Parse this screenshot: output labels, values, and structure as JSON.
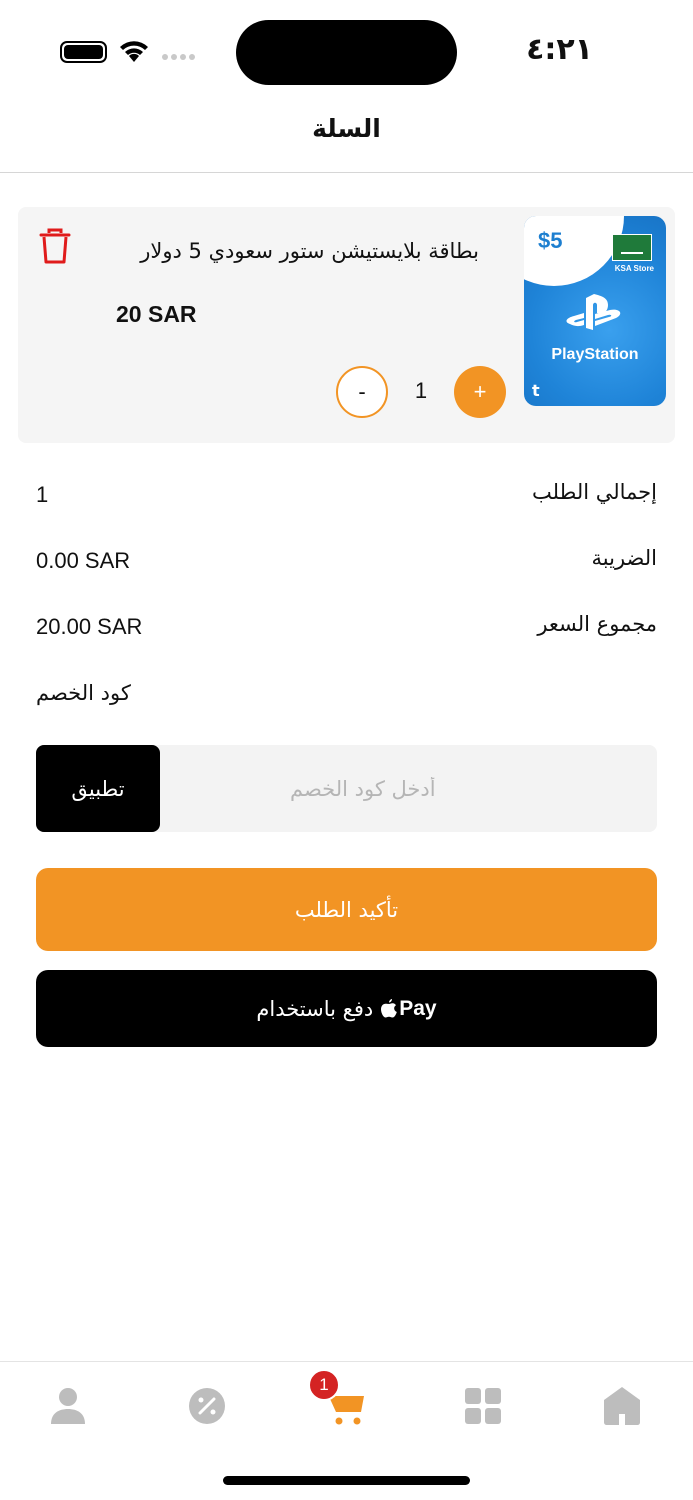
{
  "status_bar": {
    "time": "٤:٢١",
    "icons": [
      "battery-icon",
      "wifi-icon",
      "signal-icon"
    ]
  },
  "header": {
    "title": "السلة"
  },
  "cart": {
    "items": [
      {
        "name": "بطاقة بلايستيشن ستور سعودي 5 دولار",
        "price": "20 SAR",
        "quantity": "1",
        "minus_label": "-",
        "plus_label": "+",
        "image": {
          "price_tag": "$5",
          "region": "KSA Store",
          "brand": "PlayStation",
          "corner_mark": "t"
        }
      }
    ]
  },
  "summary": {
    "order_total_label": "إجمالي الطلب",
    "order_total_value": "1",
    "tax_label": "الضريبة",
    "tax_value": "0.00 SAR",
    "price_total_label": "مجموع السعر",
    "price_total_value": "20.00 SAR"
  },
  "coupon": {
    "title": "كود الخصم",
    "placeholder": "أدخل كود الخصم",
    "value": "",
    "apply_label": "تطبيق"
  },
  "actions": {
    "confirm_label": "تأكيد الطلب",
    "applepay_label": "دفع باستخدام",
    "applepay_mark": "Pay"
  },
  "tab_bar": {
    "tabs": [
      "profile-icon",
      "offers-icon",
      "cart-icon",
      "categories-icon",
      "home-icon"
    ],
    "active": "cart",
    "cart_badge": "1"
  },
  "colors": {
    "accent": "#f29424",
    "delete": "#e01b1b",
    "badge": "#d42323",
    "inactive_icon": "#bdbdbd"
  }
}
